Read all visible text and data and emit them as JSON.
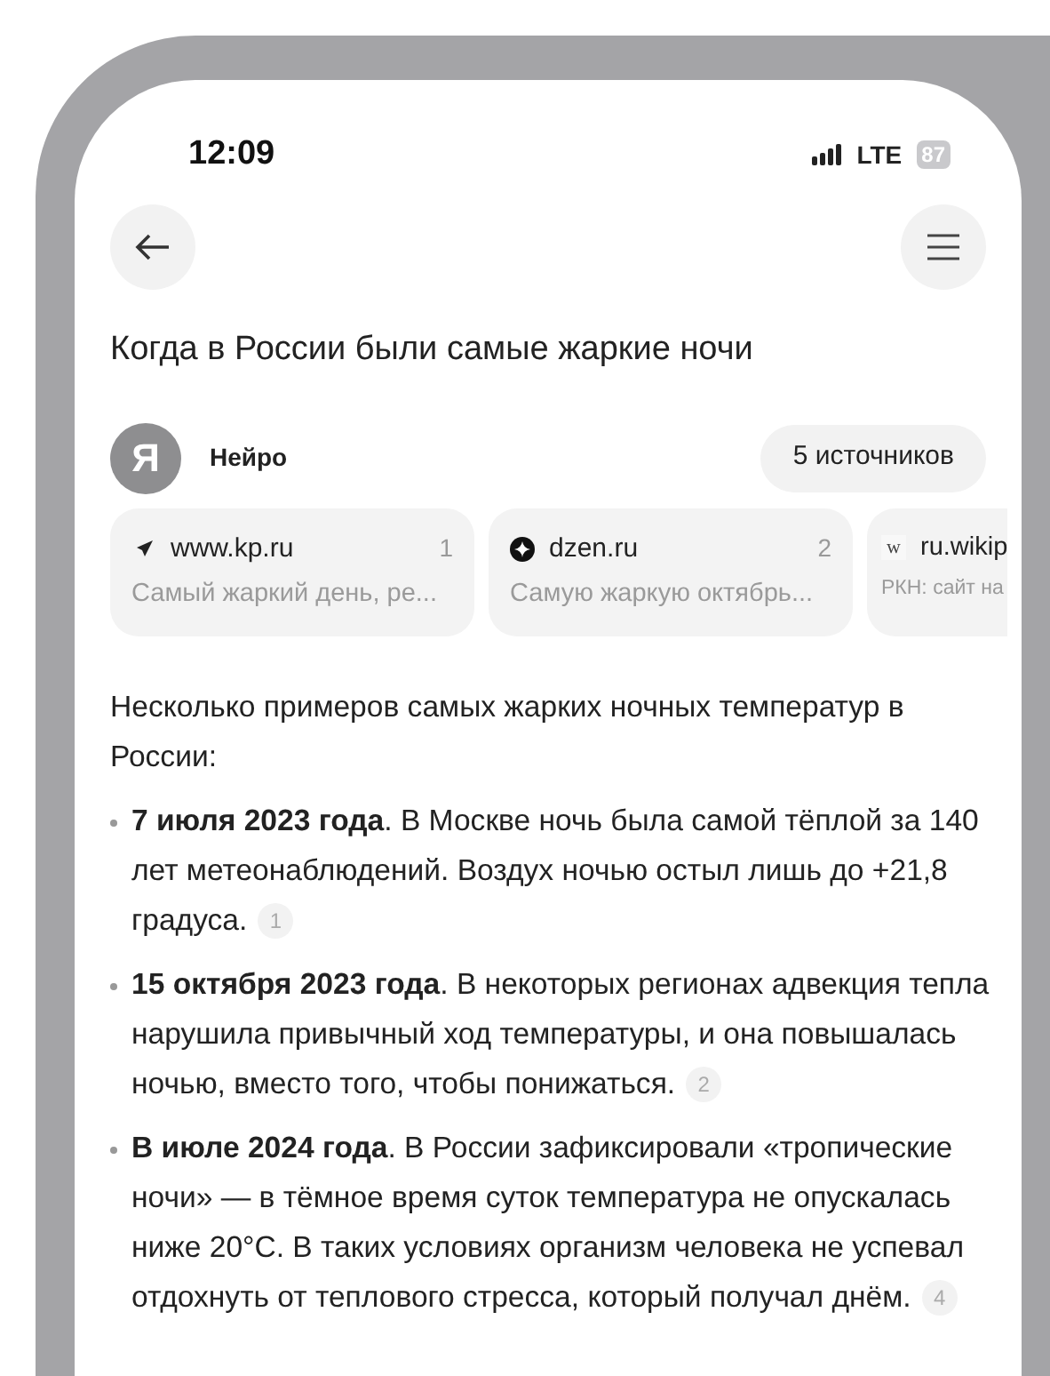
{
  "status_bar": {
    "time": "12:09",
    "network": "LTE",
    "battery": "87"
  },
  "query": "Когда в России были самые жаркие ночи",
  "assistant": {
    "logo_letter": "Я",
    "name": "Нейро",
    "sources_button": "5 источников"
  },
  "sources": [
    {
      "kind": "plane",
      "site": "www.kp.ru",
      "number": "1",
      "snippet": "Самый жаркий день, ре..."
    },
    {
      "kind": "star",
      "site": "dzen.ru",
      "number": "2",
      "snippet": "Самую жаркую октябрь..."
    },
    {
      "kind": "letter",
      "letter": "w",
      "site": "ru.wikip",
      "snippet": "РКН: сайт на"
    }
  ],
  "answer": {
    "intro": "Несколько примеров самых жарких ночных температур в России:",
    "items": [
      {
        "text": "**7 июля 2023 года**. В Москве ночь была самой тёплой за 140 лет метеонаблюдений. Воздух ночью остыл лишь до +21,8 градуса.",
        "citation": "1"
      },
      {
        "text": "**15 октября 2023 года**. В некоторых регионах адвекция тепла нарушила привычный ход температуры, и она повышалась ночью, вместо того, чтобы понижаться.",
        "citation": "2"
      },
      {
        "text": "**В июле 2024 года**. В России зафиксировали «тропические ночи» — в тёмное время суток температура не опускалась ниже 20°C. В таких условиях организм человека не успевал отдохнуть от теплового стресса, который получал днём.",
        "citation": "4"
      }
    ]
  }
}
